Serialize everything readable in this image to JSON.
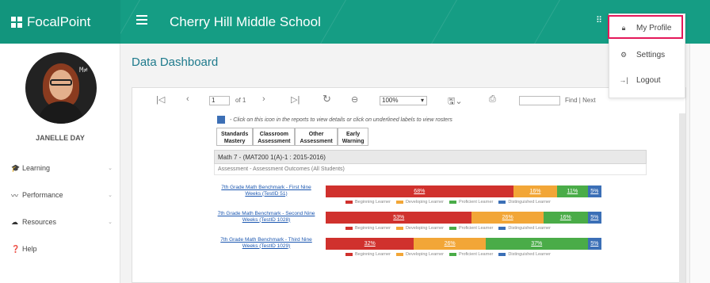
{
  "app": {
    "name": "FocalPoint",
    "school": "Cherry Hill Middle School"
  },
  "user": {
    "name": "JANELLE DAY"
  },
  "sidebar": {
    "items": [
      {
        "label": "Learning",
        "icon": "graduation-cap-icon"
      },
      {
        "label": "Performance",
        "icon": "chart-line-icon"
      },
      {
        "label": "Resources",
        "icon": "cloud-icon"
      },
      {
        "label": "Help",
        "icon": "question-circle-icon"
      }
    ]
  },
  "main": {
    "title": "Data Dashboard"
  },
  "toolbar": {
    "page": "1",
    "of_pages": "of 1",
    "zoom": "100%",
    "find_label": "Find | Next"
  },
  "report": {
    "hint": "- Click on this icon in the reports to view details or click on underlined labels to view rosters",
    "tabs": [
      {
        "line1": "Standards",
        "line2": "Mastery"
      },
      {
        "line1": "Classroom",
        "line2": "Assessment"
      },
      {
        "line1": "Other",
        "line2": "Assessment"
      },
      {
        "line1": "Early",
        "line2": "Warning"
      }
    ],
    "section_title": "Math 7 - (MAT200 1(A)-1 : 2015-2016)",
    "section_sub": "Assessment - Assessment Outcomes (All Students)",
    "legend": [
      "Beginning Learner",
      "Developing Learner",
      "Proficient Learner",
      "Distinguished Learner"
    ],
    "rows": [
      {
        "label": "7th Grade Math Benchmark - First Nine Weeks (TestID 51)",
        "values": [
          68,
          16,
          11,
          5
        ],
        "labels": [
          "68%",
          "16%",
          "11%",
          "5%"
        ]
      },
      {
        "label": "7th Grade Math Benchmark - Second Nine Weeks (TestID 1028)",
        "values": [
          53,
          26,
          16,
          5
        ],
        "labels": [
          "53%",
          "26%",
          "16%",
          "5%"
        ]
      },
      {
        "label": "7th Grade Math Benchmark - Third Nine Weeks (TestID 1029)",
        "values": [
          32,
          26,
          37,
          5
        ],
        "labels": [
          "32%",
          "26%",
          "37%",
          "5%"
        ]
      }
    ]
  },
  "colors": {
    "topbar": "#159d84",
    "beginning": "#d0312d",
    "developing": "#f2a637",
    "proficient": "#4aac48",
    "distinguished": "#3b6fb6",
    "highlight": "#e4185a"
  },
  "profile_menu": {
    "items": [
      {
        "label": "My Profile",
        "icon": "lock-icon"
      },
      {
        "label": "Settings",
        "icon": "gear-icon"
      },
      {
        "label": "Logout",
        "icon": "logout-arrow-icon"
      }
    ]
  }
}
